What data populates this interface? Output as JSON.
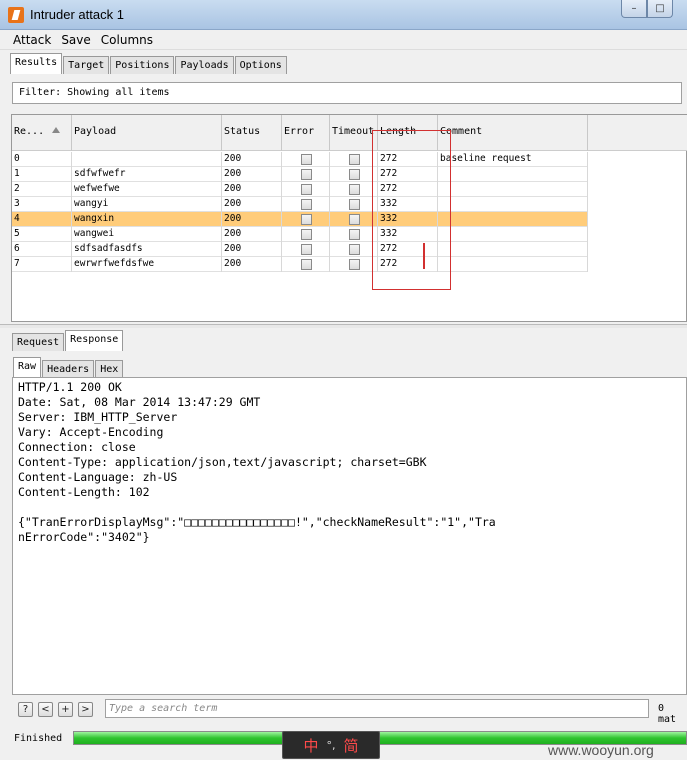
{
  "window": {
    "title": "Intruder attack 1",
    "minimize_icon": "–",
    "maximize_icon": "□"
  },
  "menu": [
    "Attack",
    "Save",
    "Columns"
  ],
  "top_tabs": [
    {
      "label": "Results",
      "active": true
    },
    {
      "label": "Target",
      "active": false
    },
    {
      "label": "Positions",
      "active": false
    },
    {
      "label": "Payloads",
      "active": false
    },
    {
      "label": "Options",
      "active": false
    }
  ],
  "filter": "Filter: Showing all items",
  "table": {
    "columns": {
      "request": "Re...",
      "payload": "Payload",
      "status": "Status",
      "error": "Error",
      "timeout": "Timeout",
      "length": "Length",
      "comment": "Comment"
    },
    "rows": [
      {
        "request": "0",
        "payload": "",
        "status": "200",
        "length": "272",
        "comment": "baseline request"
      },
      {
        "request": "1",
        "payload": "sdfwfwefr",
        "status": "200",
        "length": "272",
        "comment": ""
      },
      {
        "request": "2",
        "payload": "wefwefwe",
        "status": "200",
        "length": "272",
        "comment": ""
      },
      {
        "request": "3",
        "payload": "wangyi",
        "status": "200",
        "length": "332",
        "comment": ""
      },
      {
        "request": "4",
        "payload": "wangxin",
        "status": "200",
        "length": "332",
        "comment": "",
        "selected": true
      },
      {
        "request": "5",
        "payload": "wangwei",
        "status": "200",
        "length": "332",
        "comment": ""
      },
      {
        "request": "6",
        "payload": "sdfsadfasdfs",
        "status": "200",
        "length": "272",
        "comment": ""
      },
      {
        "request": "7",
        "payload": "ewrwrfwefdsfwe",
        "status": "200",
        "length": "272",
        "comment": ""
      }
    ]
  },
  "reqres_tabs": [
    {
      "label": "Request",
      "active": false
    },
    {
      "label": "Response",
      "active": true
    }
  ],
  "sub_tabs": [
    {
      "label": "Raw",
      "active": true
    },
    {
      "label": "Headers",
      "active": false
    },
    {
      "label": "Hex",
      "active": false
    }
  ],
  "response_lines": [
    "HTTP/1.1 200 OK",
    "Date: Sat, 08 Mar 2014 13:47:29 GMT",
    "Server: IBM_HTTP_Server",
    "Vary: Accept-Encoding",
    "Connection: close",
    "Content-Type: application/json,text/javascript; charset=GBK",
    "Content-Language: zh-US",
    "Content-Length: 102",
    "",
    "{\"TranErrorDisplayMsg\":\"□□□□□□□□□□□□□□□□!\",\"checkNameResult\":\"1\",\"Tra",
    "nErrorCode\":\"3402\"}"
  ],
  "search": {
    "placeholder": "Type a search term",
    "buttons": [
      "?",
      "<",
      "+",
      ">"
    ],
    "match_count": "0 mat"
  },
  "status": {
    "text": "Finished",
    "progress": 1.0
  },
  "ime": [
    "中",
    "°,",
    "简"
  ],
  "watermark": "www.wooyun.org"
}
